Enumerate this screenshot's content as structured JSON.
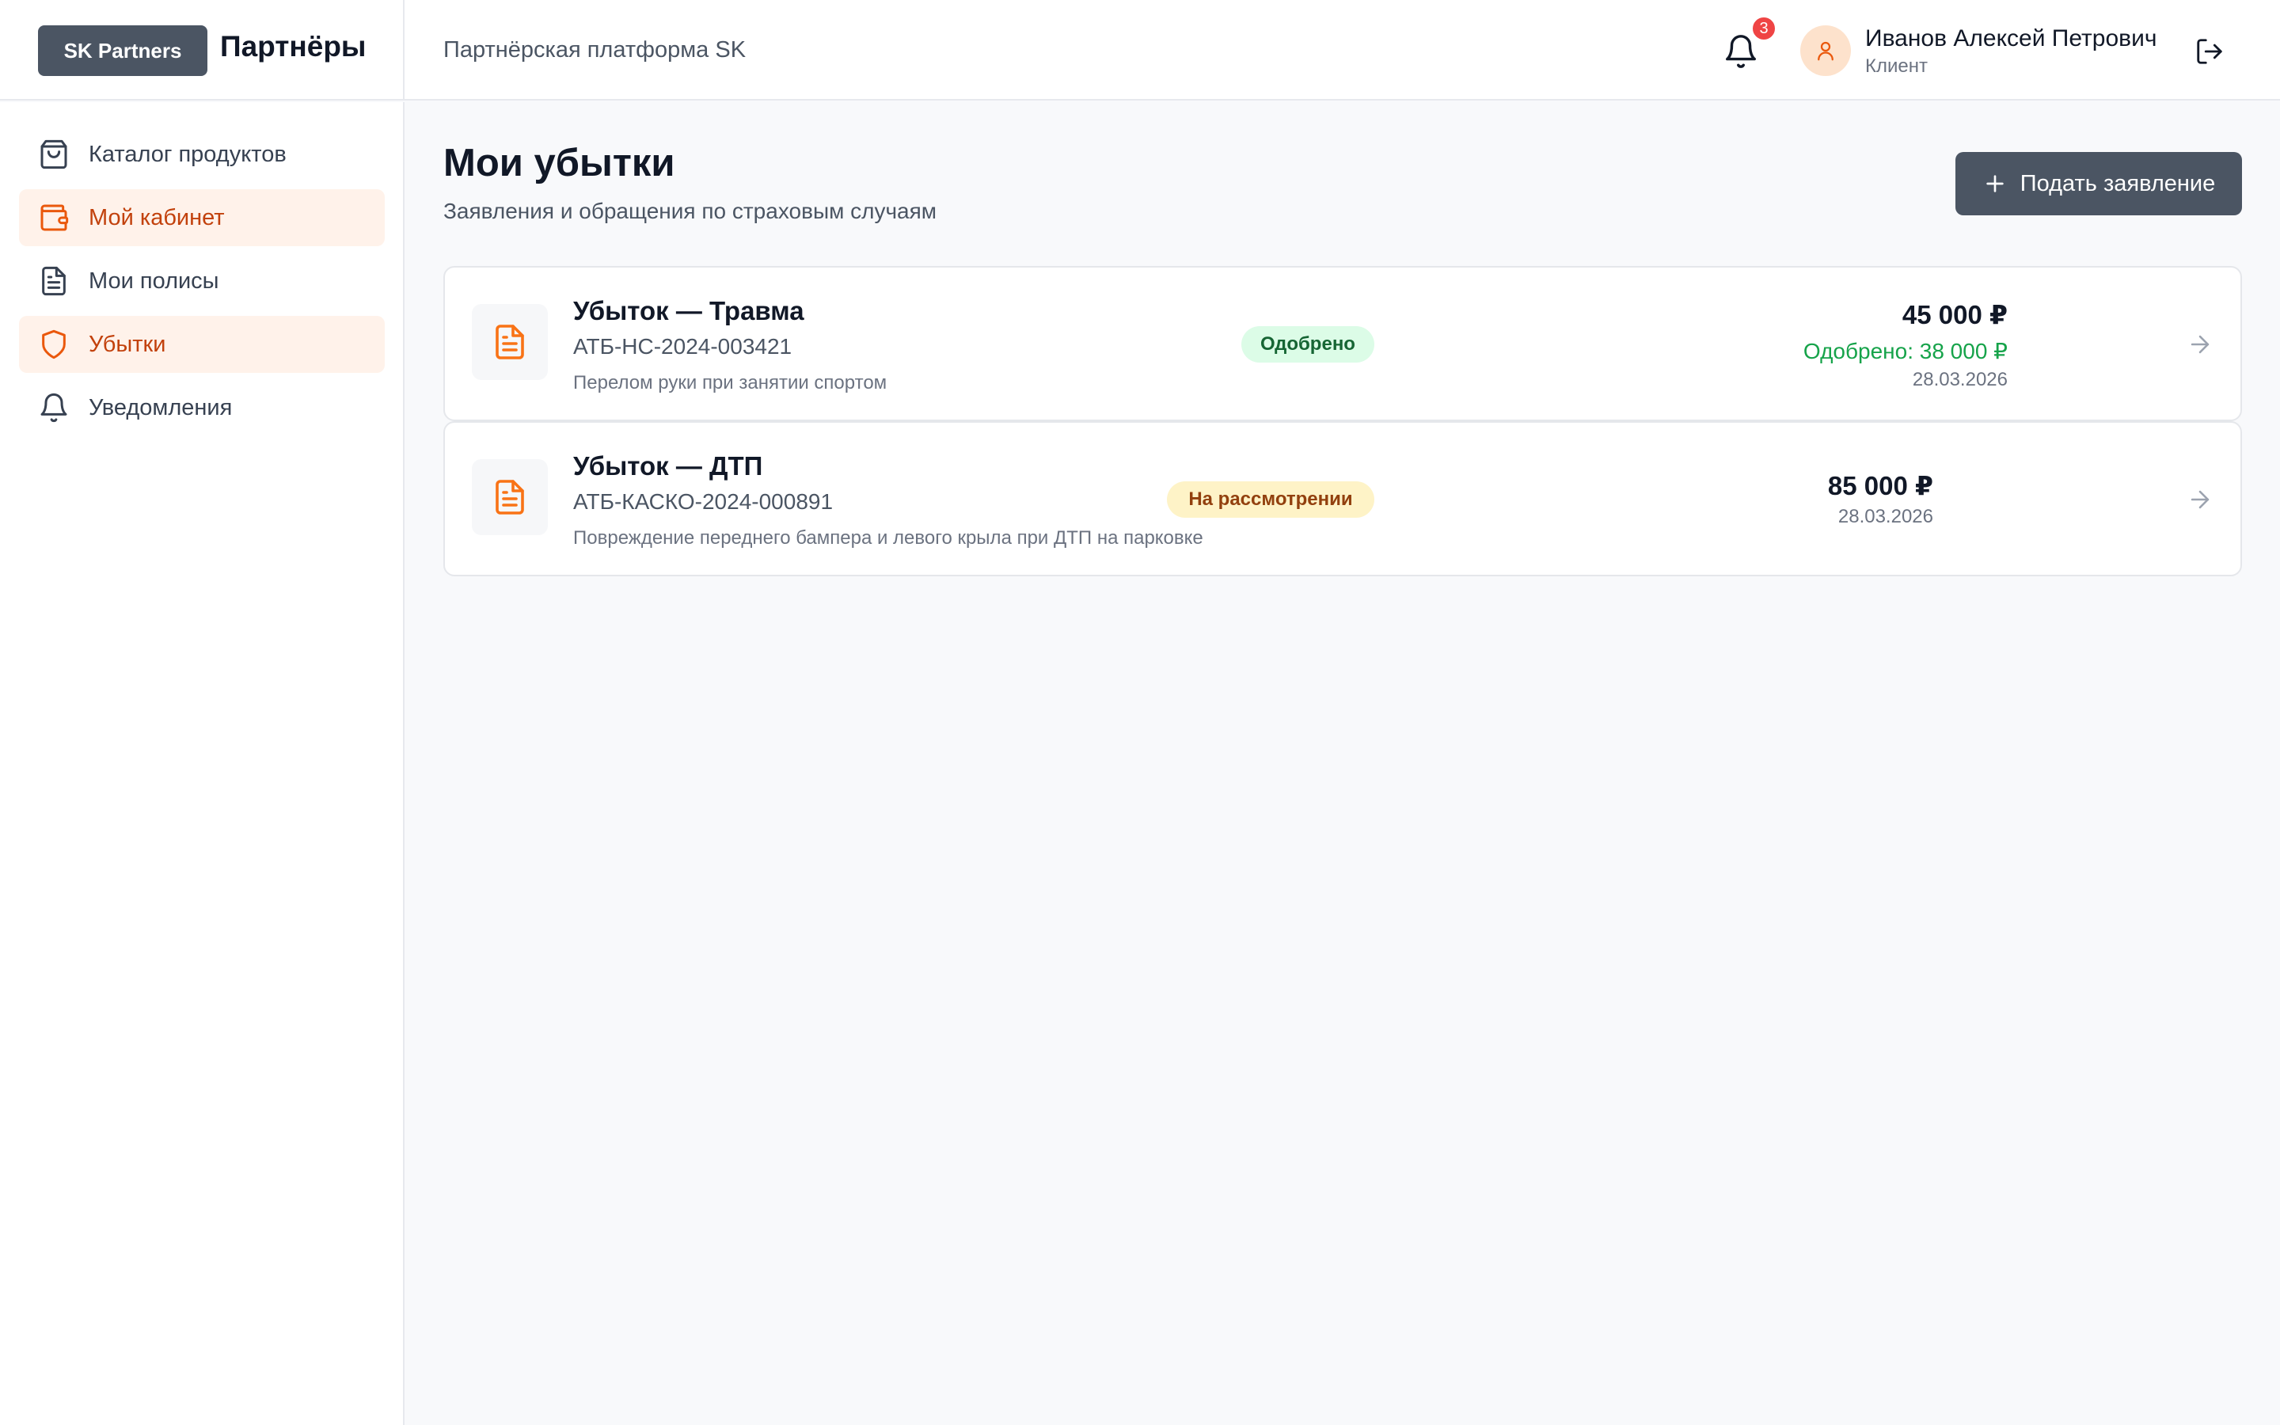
{
  "header": {
    "brand_badge": "SK Partners",
    "brand_name": "Партнёры",
    "platform_title": "Партнёрская платформа SK",
    "notifications_count": "3",
    "user_name": "Иванов Алексей Петрович",
    "user_role": "Клиент"
  },
  "sidebar": {
    "items": [
      {
        "label": "Каталог продуктов",
        "icon": "shopping-bag-icon",
        "active": false
      },
      {
        "label": "Мой кабинет",
        "icon": "wallet-icon",
        "active": true
      },
      {
        "label": "Мои полисы",
        "icon": "document-icon",
        "active": false
      },
      {
        "label": "Убытки",
        "icon": "shield-icon",
        "active": true
      },
      {
        "label": "Уведомления",
        "icon": "bell-icon",
        "active": false
      }
    ]
  },
  "main": {
    "title": "Мои убытки",
    "subtitle": "Заявления и обращения по страховым случаям",
    "submit_button": "Подать заявление",
    "claims": [
      {
        "title": "Убыток — Травма",
        "number": "АТБ-НС-2024-003421",
        "description": "Перелом руки при занятии спортом",
        "amount": "45 000 ₽",
        "approved_amount": "Одобрено: 38 000 ₽",
        "date": "28.03.2026",
        "status": "Одобрено"
      },
      {
        "title": "Убыток — ДТП",
        "number": "АТБ-КАСКО-2024-000891",
        "description": "Повреждение переднего бампера и левого крыла при ДТП на парковке",
        "amount": "85 000 ₽",
        "date": "28.03.2026",
        "status": "На рассмотрении"
      }
    ]
  },
  "colors": {
    "accent": "#f97316",
    "active_bg": "#fff2ea",
    "active_text": "#c2410c",
    "approved": "#16a34a",
    "review": "#92400e",
    "dark_button": "#4b5563"
  }
}
